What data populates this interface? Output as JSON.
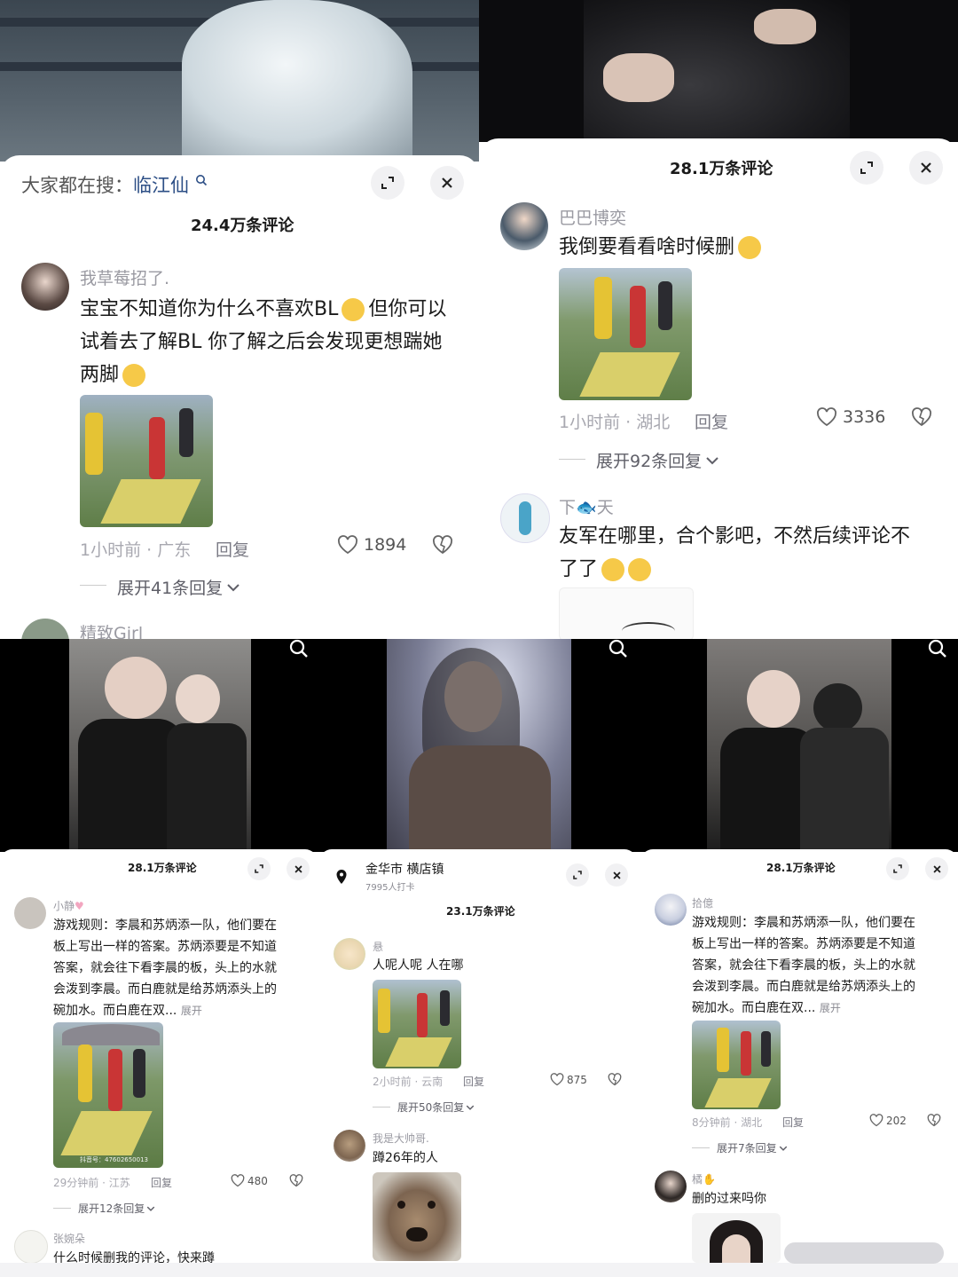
{
  "top_left": {
    "search_prefix": "大家都在搜：",
    "search_term": "临江仙",
    "count": "24.4万条评论",
    "comment": {
      "user": "我草莓招了.",
      "line1": "宝宝不知道你为什么不喜欢BL",
      "line1b": "但你可以",
      "line2": "试着去了解BL 你了解之后会发现更想踹她",
      "line3": "两脚",
      "time_loc": "1小时前 · 广东",
      "reply": "回复",
      "likes": "1894",
      "expand": "展开41条回复"
    },
    "next_user": "精致Girl"
  },
  "top_right": {
    "count": "28.1万条评论",
    "c1": {
      "user": "巴巴博奕",
      "text": "我倒要看看啥时候删",
      "time_loc": "1小时前 · 湖北",
      "reply": "回复",
      "likes": "3336",
      "expand": "展开92条回复"
    },
    "c2": {
      "user_a": "下",
      "user_b": "天",
      "line1": "友军在哪里，合个影吧，不然后续评论不",
      "line2": "了了"
    }
  },
  "bottom_left": {
    "count": "28.1万条评论",
    "c1": {
      "user": "小静",
      "lines": [
        "游戏规则：李晨和苏炳添一队，他们要在",
        "板上写出一样的答案。苏炳添要是不知道",
        "答案，就会往下看李晨的板，头上的水就",
        "会泼到李晨。而白鹿就是给苏炳添头上的",
        "碗加水。而白鹿在双..."
      ],
      "more": "展开",
      "watermark": "抖音号：47602650013",
      "time_loc": "29分钟前 · 江苏",
      "reply": "回复",
      "likes": "480",
      "expand": "展开12条回复"
    },
    "c2": {
      "user": "张婉朵",
      "text": "什么时候删我的评论，快来蹲"
    }
  },
  "bottom_mid": {
    "location": "金华市 横店镇",
    "checkins": "7995人打卡",
    "count": "23.1万条评论",
    "c1": {
      "user": "悬",
      "text": "人呢人呢 人在哪",
      "time_loc": "2小时前 · 云南",
      "reply": "回复",
      "likes": "875",
      "expand": "展开50条回复"
    },
    "c2": {
      "user": "我是大帅哥.",
      "text": "蹲26年的人"
    }
  },
  "bottom_right": {
    "count": "28.1万条评论",
    "c1": {
      "user": "拾億",
      "lines": [
        "游戏规则：李晨和苏炳添一队，他们要在",
        "板上写出一样的答案。苏炳添要是不知道",
        "答案，就会往下看李晨的板，头上的水就",
        "会泼到李晨。而白鹿就是给苏炳添头上的",
        "碗加水。而白鹿在双..."
      ],
      "more": "展开",
      "time_loc": "8分钟前 · 湖北",
      "reply": "回复",
      "likes": "202",
      "expand": "展开7条回复"
    },
    "c2": {
      "user": "橘",
      "text": "删的过来吗你"
    }
  },
  "icons": [
    "search-icon",
    "expand-icon",
    "close-icon",
    "heart-icon",
    "dislike-icon",
    "location-pin-icon",
    "chevron-down-icon"
  ],
  "colors": {
    "link_blue": "#2d4f86",
    "muted": "#9a9aa2",
    "button_bg": "#f1f1f3"
  }
}
